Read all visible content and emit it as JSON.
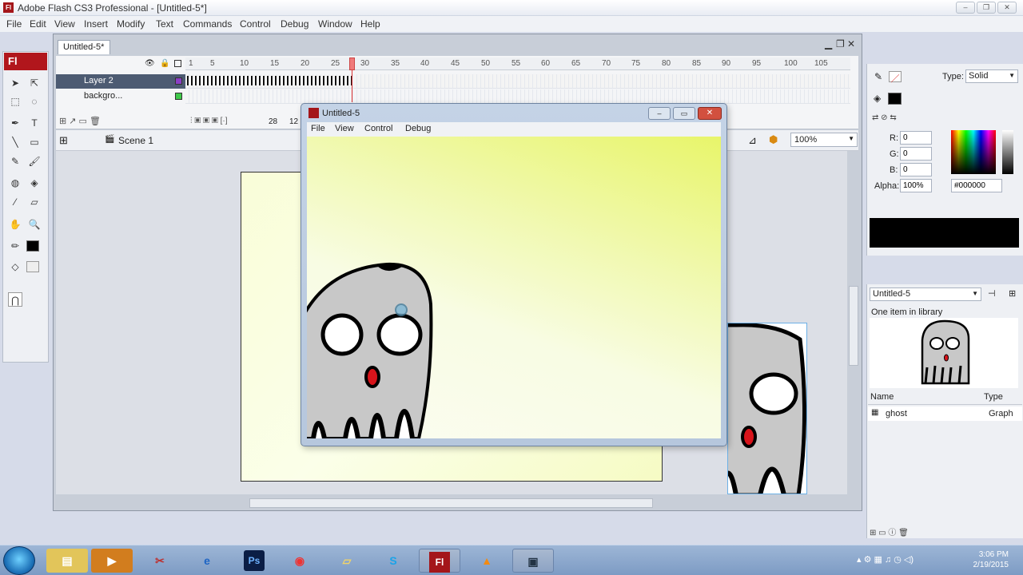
{
  "app": {
    "title": "Adobe Flash CS3 Professional - [Untitled-5*]",
    "logo": "Fl",
    "menu": [
      "File",
      "Edit",
      "View",
      "Insert",
      "Modify",
      "Text",
      "Commands",
      "Control",
      "Debug",
      "Window",
      "Help"
    ]
  },
  "document": {
    "tab": "Untitled-5*",
    "scene": "Scene 1",
    "zoom": "100%"
  },
  "timeline": {
    "ruler": [
      "1",
      "5",
      "10",
      "15",
      "20",
      "25",
      "30",
      "35",
      "40",
      "45",
      "50",
      "55",
      "60",
      "65",
      "70",
      "75",
      "80",
      "85",
      "90",
      "95",
      "100",
      "105"
    ],
    "layers": [
      {
        "name": "Layer 2",
        "selected": true
      },
      {
        "name": "backgro..."
      }
    ],
    "current_frame": "28",
    "fps": "12"
  },
  "player": {
    "title": "Untitled-5",
    "menu": [
      "File",
      "View",
      "Control",
      "Debug"
    ]
  },
  "color_panel": {
    "type_label": "Type:",
    "type_value": "Solid",
    "r_label": "R:",
    "r": "0",
    "g_label": "G:",
    "g": "0",
    "b_label": "B:",
    "b": "0",
    "alpha_label": "Alpha:",
    "alpha": "100%",
    "hex": "#000000",
    "swatch_color": "#000000"
  },
  "library": {
    "document": "Untitled-5",
    "count_text": "One item in library",
    "col_name": "Name",
    "col_type": "Type",
    "items": [
      {
        "name": "ghost",
        "type": "Graph"
      }
    ]
  },
  "taskbar": {
    "time": "3:06 PM",
    "date": "2/19/2015",
    "apps": [
      "explorer",
      "media",
      "tools",
      "ie",
      "Ps",
      "chrome",
      "folder",
      "skype",
      "Fl",
      "vlc",
      "recorder"
    ]
  }
}
